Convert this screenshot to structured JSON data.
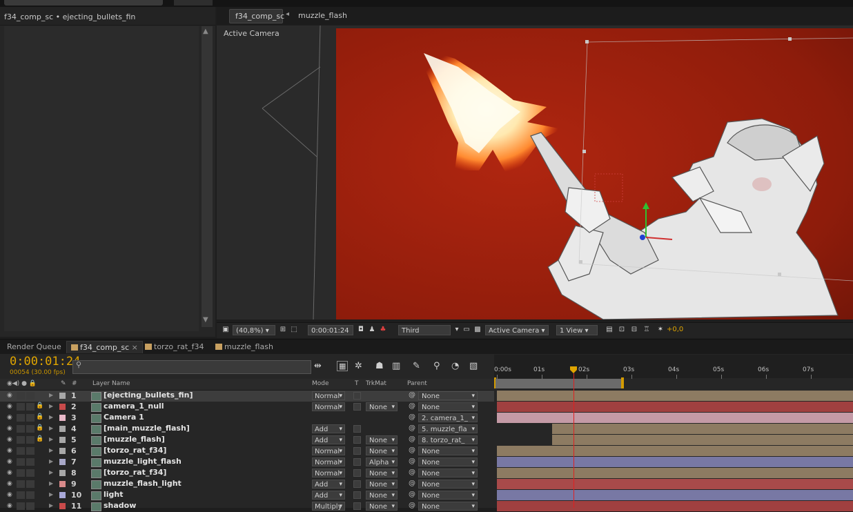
{
  "project_panel": {
    "title": "f34_comp_sc • ejecting_bullets_fin"
  },
  "viewer": {
    "tab_label": "f34_comp_sc",
    "breadcrumb": "muzzle_flash",
    "camera_label": "Active Camera"
  },
  "viewer_toolbar": {
    "zoom": "(40,8%)",
    "timecode": "0:00:01:24",
    "resolution": "Third",
    "camera_view": "Active Camera",
    "view_layout": "1 View",
    "exposure": "+0,0"
  },
  "timeline_tabs": [
    {
      "label": "Render Queue",
      "color": ""
    },
    {
      "label": "f34_comp_sc",
      "color": "#c8a060"
    },
    {
      "label": "torzo_rat_f34",
      "color": "#c8a060"
    },
    {
      "label": "muzzle_flash",
      "color": "#c8a060"
    }
  ],
  "timeline": {
    "timecode": "0:00:01:24",
    "fps": "00054 (30.00 fps)",
    "search_placeholder": "",
    "columns": {
      "hash": "#",
      "layer_name": "Layer Name",
      "mode": "Mode",
      "t": "T",
      "trkmat": "TrkMat",
      "parent": "Parent"
    },
    "ruler_ticks": [
      "0:00s",
      "01s",
      "02s",
      "03s",
      "04s",
      "05s",
      "06s",
      "07s"
    ],
    "playhead_seconds": 1.8
  },
  "layers": [
    {
      "num": "1",
      "name": "[ejecting_bullets_fin]",
      "color": "#a8a8a8",
      "mode": "Normal",
      "trkmat": "",
      "parent": "None",
      "locked": false,
      "selected": true,
      "bar_color": "#8d7b62",
      "bar_start": 0
    },
    {
      "num": "2",
      "name": "camera_1_null",
      "color": "#c84a4a",
      "mode": "Normal",
      "trkmat": "None",
      "parent": "None",
      "locked": true,
      "selected": false,
      "bar_color": "#a04040",
      "bar_start": 0
    },
    {
      "num": "3",
      "name": "Camera 1",
      "color": "#e8b8c8",
      "mode": "",
      "trkmat": "",
      "parent": "2. camera_1_",
      "locked": true,
      "selected": false,
      "bar_color": "#c49aa6",
      "bar_start": 0
    },
    {
      "num": "4",
      "name": "[main_muzzle_flash]",
      "color": "#a8a8a8",
      "mode": "Add",
      "trkmat": "",
      "parent": "5. muzzle_fla",
      "locked": true,
      "selected": false,
      "bar_color": "#8d7b62",
      "bar_start": 1.3
    },
    {
      "num": "5",
      "name": "[muzzle_flash]",
      "color": "#a8a8a8",
      "mode": "Add",
      "trkmat": "None",
      "parent": "8. torzo_rat_",
      "locked": true,
      "selected": false,
      "bar_color": "#8d7b62",
      "bar_start": 1.3
    },
    {
      "num": "6",
      "name": "[torzo_rat_f34]",
      "color": "#a8a8a8",
      "mode": "Normal",
      "trkmat": "None",
      "parent": "None",
      "locked": false,
      "selected": false,
      "bar_color": "#8d7b62",
      "bar_start": 0
    },
    {
      "num": "7",
      "name": "muzzle_light_flash",
      "color": "#a8a8c8",
      "mode": "Normal",
      "trkmat": "Alpha",
      "parent": "None",
      "locked": false,
      "selected": false,
      "bar_color": "#7878a4",
      "bar_start": 0
    },
    {
      "num": "8",
      "name": "[torzo_rat_f34]",
      "color": "#a8a8a8",
      "mode": "Normal",
      "trkmat": "None",
      "parent": "None",
      "locked": false,
      "selected": false,
      "bar_color": "#8d7b62",
      "bar_start": 0
    },
    {
      "num": "9",
      "name": "muzzle_flash_light",
      "color": "#d88a8a",
      "mode": "Add",
      "trkmat": "None",
      "parent": "None",
      "locked": false,
      "selected": false,
      "bar_color": "#a84a4a",
      "bar_start": 0
    },
    {
      "num": "10",
      "name": "light",
      "color": "#a8a8d8",
      "mode": "Add",
      "trkmat": "None",
      "parent": "None",
      "locked": false,
      "selected": false,
      "bar_color": "#7878a4",
      "bar_start": 0
    },
    {
      "num": "11",
      "name": "shadow",
      "color": "#c84a4a",
      "mode": "Multiply",
      "trkmat": "None",
      "parent": "None",
      "locked": false,
      "selected": false,
      "bar_color": "#a04040",
      "bar_start": 0
    }
  ]
}
